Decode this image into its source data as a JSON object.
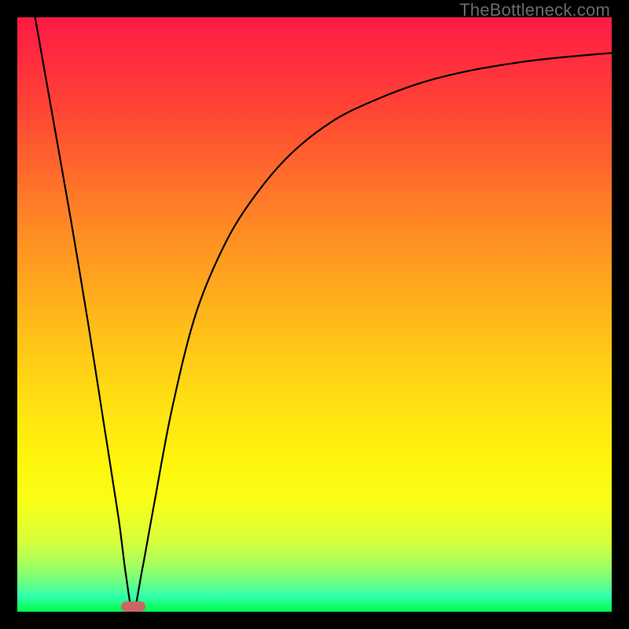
{
  "watermark": "TheBottleneck.com",
  "colors": {
    "frame": "#000000",
    "curve_stroke": "#000000",
    "marker": "#cc6666",
    "watermark_text": "#6b6b6b"
  },
  "chart_data": {
    "type": "line",
    "title": "",
    "xlabel": "",
    "ylabel": "",
    "xlim": [
      0,
      100
    ],
    "ylim": [
      0,
      100
    ],
    "grid": false,
    "legend": false,
    "background_gradient": {
      "orientation": "vertical",
      "stops": [
        {
          "pos": 0,
          "color": "#ff1a44"
        },
        {
          "pos": 40,
          "color": "#ff8c24"
        },
        {
          "pos": 70,
          "color": "#ffe311"
        },
        {
          "pos": 90,
          "color": "#a6ff5e"
        },
        {
          "pos": 100,
          "color": "#00ff52"
        }
      ]
    },
    "series": [
      {
        "name": "bottleneck-curve",
        "x": [
          3,
          6,
          9,
          12,
          14.5,
          17,
          18.3,
          19.5,
          21,
          23,
          26,
          30,
          35,
          40,
          46,
          53,
          60,
          68,
          76,
          85,
          92,
          100
        ],
        "y": [
          100,
          83,
          66,
          48,
          32,
          16,
          6,
          0,
          7,
          18,
          34,
          50,
          62,
          70,
          77,
          82.5,
          86,
          89,
          91,
          92.5,
          93.3,
          94
        ]
      }
    ],
    "marker": {
      "name": "optimal-range",
      "x_center": 19.5,
      "y": 0,
      "width_pct": 4.2,
      "color": "#cc6666"
    },
    "notes": "Axes have no numeric tick labels; all values are estimated proportions (0–100) read from pixel positions. The V-shaped curve touches y=0 at roughly x≈19.5 and rises asymptotically toward ~94 on the right."
  }
}
